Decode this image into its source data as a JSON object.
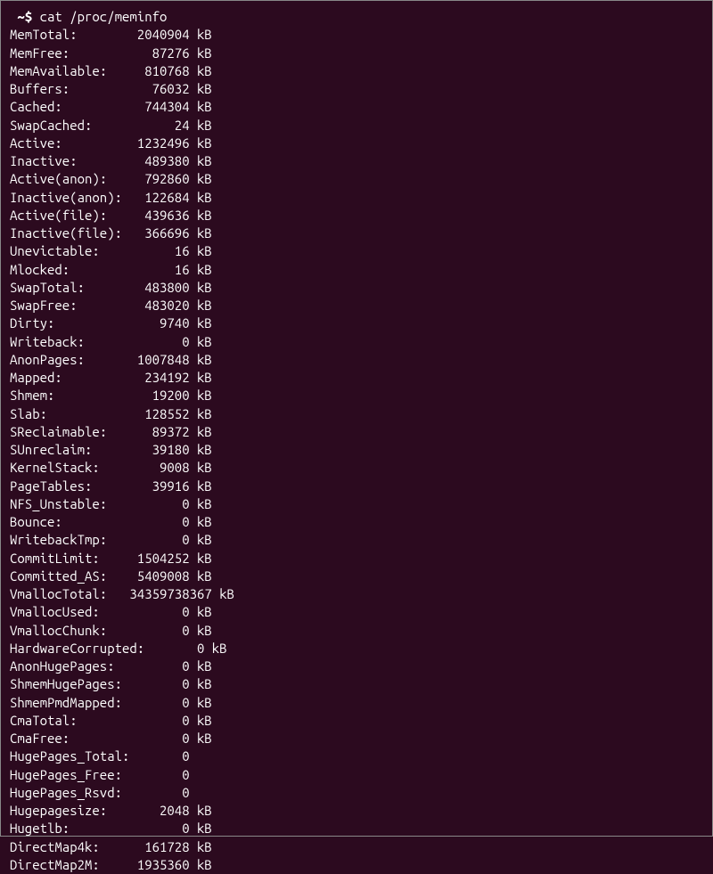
{
  "prompt": " ~$ ",
  "command": "cat /proc/meminfo",
  "rows": [
    {
      "label": "MemTotal:",
      "value": "2040904",
      "unit": "kB"
    },
    {
      "label": "MemFree:",
      "value": "87276",
      "unit": "kB"
    },
    {
      "label": "MemAvailable:",
      "value": "810768",
      "unit": "kB"
    },
    {
      "label": "Buffers:",
      "value": "76032",
      "unit": "kB"
    },
    {
      "label": "Cached:",
      "value": "744304",
      "unit": "kB"
    },
    {
      "label": "SwapCached:",
      "value": "24",
      "unit": "kB"
    },
    {
      "label": "Active:",
      "value": "1232496",
      "unit": "kB"
    },
    {
      "label": "Inactive:",
      "value": "489380",
      "unit": "kB"
    },
    {
      "label": "Active(anon):",
      "value": "792860",
      "unit": "kB"
    },
    {
      "label": "Inactive(anon):",
      "value": "122684",
      "unit": "kB"
    },
    {
      "label": "Active(file):",
      "value": "439636",
      "unit": "kB"
    },
    {
      "label": "Inactive(file):",
      "value": "366696",
      "unit": "kB"
    },
    {
      "label": "Unevictable:",
      "value": "16",
      "unit": "kB"
    },
    {
      "label": "Mlocked:",
      "value": "16",
      "unit": "kB"
    },
    {
      "label": "SwapTotal:",
      "value": "483800",
      "unit": "kB"
    },
    {
      "label": "SwapFree:",
      "value": "483020",
      "unit": "kB"
    },
    {
      "label": "Dirty:",
      "value": "9740",
      "unit": "kB"
    },
    {
      "label": "Writeback:",
      "value": "0",
      "unit": "kB"
    },
    {
      "label": "AnonPages:",
      "value": "1007848",
      "unit": "kB"
    },
    {
      "label": "Mapped:",
      "value": "234192",
      "unit": "kB"
    },
    {
      "label": "Shmem:",
      "value": "19200",
      "unit": "kB"
    },
    {
      "label": "Slab:",
      "value": "128552",
      "unit": "kB"
    },
    {
      "label": "SReclaimable:",
      "value": "89372",
      "unit": "kB"
    },
    {
      "label": "SUnreclaim:",
      "value": "39180",
      "unit": "kB"
    },
    {
      "label": "KernelStack:",
      "value": "9008",
      "unit": "kB"
    },
    {
      "label": "PageTables:",
      "value": "39916",
      "unit": "kB"
    },
    {
      "label": "NFS_Unstable:",
      "value": "0",
      "unit": "kB"
    },
    {
      "label": "Bounce:",
      "value": "0",
      "unit": "kB"
    },
    {
      "label": "WritebackTmp:",
      "value": "0",
      "unit": "kB"
    },
    {
      "label": "CommitLimit:",
      "value": "1504252",
      "unit": "kB"
    },
    {
      "label": "Committed_AS:",
      "value": "5409008",
      "unit": "kB"
    },
    {
      "label": "VmallocTotal:",
      "value": "34359738367",
      "unit": "kB"
    },
    {
      "label": "VmallocUsed:",
      "value": "0",
      "unit": "kB"
    },
    {
      "label": "VmallocChunk:",
      "value": "0",
      "unit": "kB"
    },
    {
      "label": "HardwareCorrupted:",
      "value": "0",
      "unit": "kB"
    },
    {
      "label": "AnonHugePages:",
      "value": "0",
      "unit": "kB"
    },
    {
      "label": "ShmemHugePages:",
      "value": "0",
      "unit": "kB"
    },
    {
      "label": "ShmemPmdMapped:",
      "value": "0",
      "unit": "kB"
    },
    {
      "label": "CmaTotal:",
      "value": "0",
      "unit": "kB"
    },
    {
      "label": "CmaFree:",
      "value": "0",
      "unit": "kB"
    },
    {
      "label": "HugePages_Total:",
      "value": "0",
      "unit": ""
    },
    {
      "label": "HugePages_Free:",
      "value": "0",
      "unit": ""
    },
    {
      "label": "HugePages_Rsvd:",
      "value": "0",
      "unit": ""
    },
    {
      "label": "Hugepagesize:",
      "value": "2048",
      "unit": "kB"
    },
    {
      "label": "Hugetlb:",
      "value": "0",
      "unit": "kB"
    },
    {
      "label": "DirectMap4k:",
      "value": "161728",
      "unit": "kB"
    },
    {
      "label": "DirectMap2M:",
      "value": "1935360",
      "unit": "kB"
    }
  ]
}
